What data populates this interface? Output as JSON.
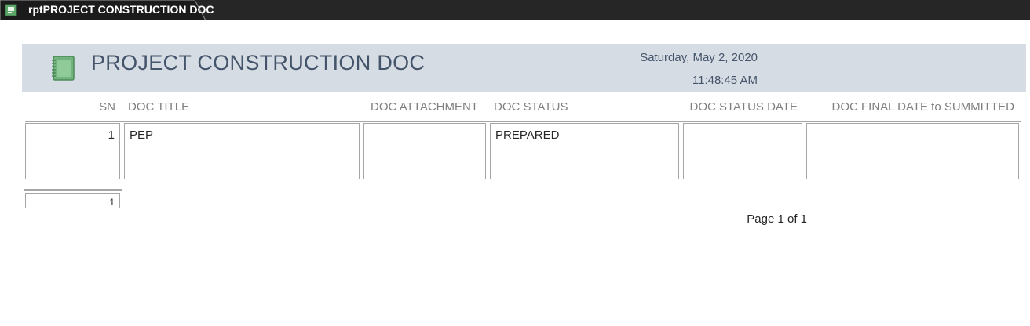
{
  "tab": {
    "title": "rptPROJECT CONSTRUCTION DOC",
    "icon": "report-icon"
  },
  "header": {
    "title": "PROJECT CONSTRUCTION DOC",
    "date": "Saturday, May 2, 2020",
    "time": "11:48:45 AM",
    "icon": "notebook-icon",
    "band_color": "#d6dce4"
  },
  "columns": [
    "SN",
    "DOC TITLE",
    "DOC ATTACHMENT",
    "DOC STATUS",
    "DOC STATUS DATE",
    "DOC FINAL DATE to SUMMITTED"
  ],
  "rows": [
    {
      "sn": "1",
      "doc_title": "PEP",
      "doc_attachment": "",
      "doc_status": "PREPARED",
      "doc_status_date": "",
      "doc_final_date": ""
    }
  ],
  "footer": {
    "count": "1",
    "page": "Page 1 of 1"
  }
}
